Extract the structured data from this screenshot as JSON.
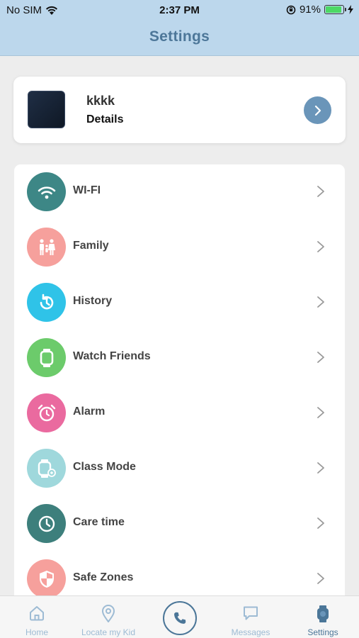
{
  "status_bar": {
    "carrier": "No SIM",
    "time": "2:37 PM",
    "battery_percent": "91%",
    "battery_level": 0.91
  },
  "header": {
    "title": "Settings"
  },
  "profile": {
    "name": "kkkk",
    "details_label": "Details"
  },
  "menu": {
    "items": [
      {
        "label": "WI-FI",
        "icon": "wifi-icon",
        "color": "#3d8786"
      },
      {
        "label": "Family",
        "icon": "family-icon",
        "color": "#f6a09c"
      },
      {
        "label": "History",
        "icon": "history-icon",
        "color": "#2fc3e8"
      },
      {
        "label": "Watch Friends",
        "icon": "watch-icon",
        "color": "#6ccb6b"
      },
      {
        "label": "Alarm",
        "icon": "alarm-icon",
        "color": "#ea6a9f"
      },
      {
        "label": "Class Mode",
        "icon": "class-mode-icon",
        "color": "#9fd8dc"
      },
      {
        "label": "Care time",
        "icon": "clock-icon",
        "color": "#3d7f7c"
      },
      {
        "label": "Safe Zones",
        "icon": "shield-icon",
        "color": "#f6a09c"
      }
    ]
  },
  "tab_bar": {
    "tabs": [
      {
        "label": "Home",
        "icon": "home-icon"
      },
      {
        "label": "Locate my Kid",
        "icon": "location-pin-icon"
      },
      {
        "label": "",
        "icon": "phone-icon"
      },
      {
        "label": "Messages",
        "icon": "chat-icon"
      },
      {
        "label": "Settings",
        "icon": "watch-icon"
      }
    ],
    "active_color": "#4b7698",
    "inactive_color": "#9dbbd4"
  }
}
